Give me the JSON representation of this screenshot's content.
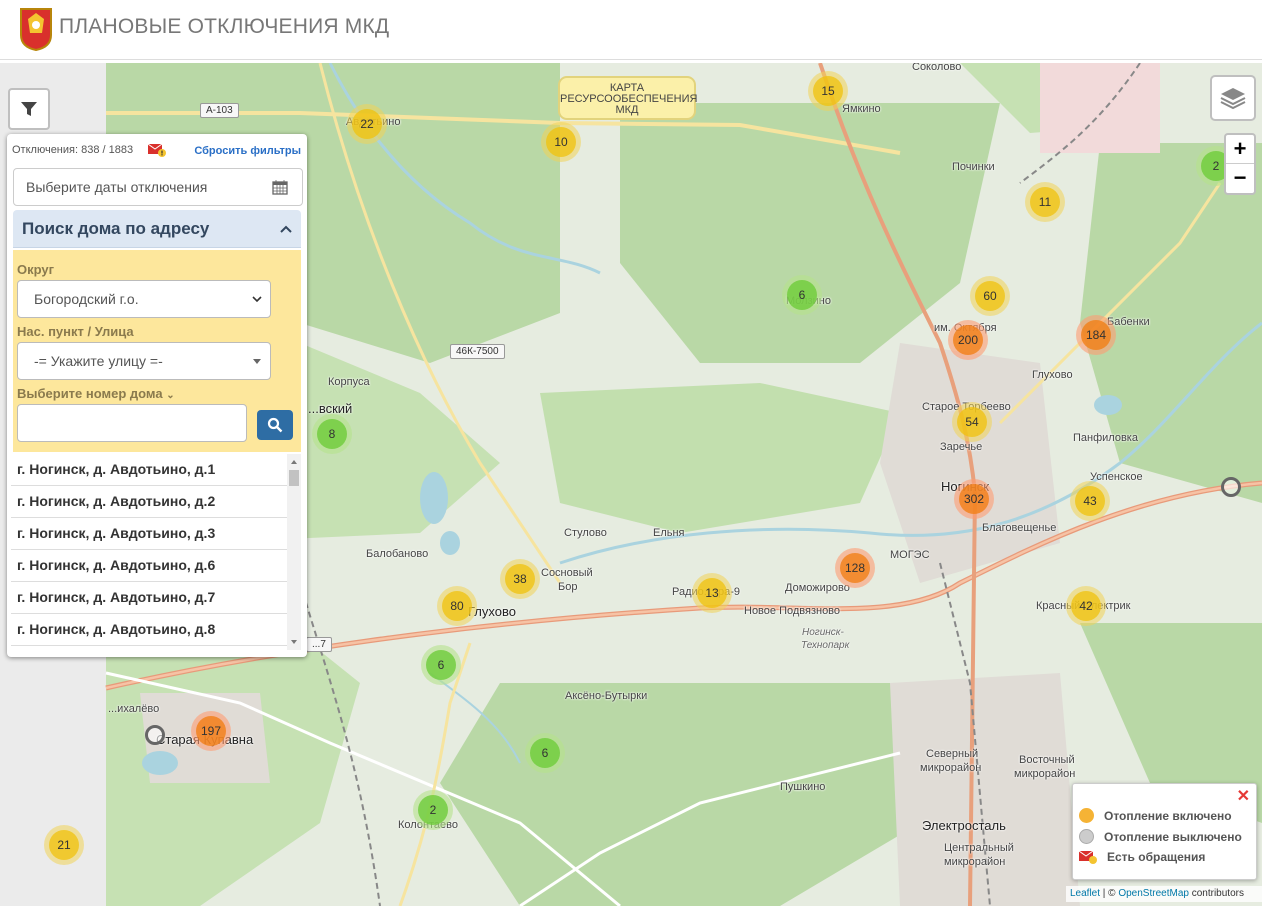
{
  "header": {
    "title": "ПЛАНОВЫЕ ОТКЛЮЧЕНИЯ МКД"
  },
  "map": {
    "overlay_label": [
      "КАРТА",
      "РЕСУРСООБЕСПЕЧЕНИЯ",
      "МКД"
    ],
    "clusters": [
      "22",
      "10",
      "15",
      "2",
      "11",
      "6",
      "60",
      "200",
      "184",
      "8",
      "54",
      "302",
      "43",
      "38",
      "80",
      "13",
      "128",
      "42",
      "6",
      "6",
      "2",
      "197",
      "21"
    ],
    "place_labels": [
      "Соколово",
      "Ямкино",
      "Починки",
      "Авдотьино",
      "Молзино",
      "им. Октября",
      "Бабенки",
      "Глухово",
      "Старое Торбеево",
      "Заречье",
      "Панфиловка",
      "Ногинск",
      "Успенское",
      "Благовещенье",
      "Корпуса",
      "...вский",
      "Стулово",
      "Ельня",
      "Балобаново",
      "Сосновый",
      "Бор",
      "Глухово",
      "Радио...тра-9",
      "Доможирово",
      "МОГЭС",
      "Новое Подвязново",
      "Ногинск-",
      "Технопарк",
      "Красный Электрик",
      "Аксёно-Бутырки",
      "...ихалёво",
      "Старая Купавна",
      "Северный",
      "микрорайон",
      "Восточный",
      "микрорайон",
      "Пушкино",
      "Электросталь",
      "Центральный",
      "микрорайон",
      "Колонтаево"
    ],
    "road_shields": [
      "А-103",
      "46К-7500",
      "...7"
    ]
  },
  "panel": {
    "stats": "Отключения: 838 / 1883",
    "reset_label": "Сбросить фильтры",
    "date_placeholder": "Выберите даты отключения",
    "search_title": "Поиск дома по адресу",
    "district_label": "Округ",
    "district_value": "Богородский г.о.",
    "street_label": "Нас. пункт / Улица",
    "street_value": "-= Укажите улицу =-",
    "house_label": "Выберите номер дома",
    "results": [
      "г. Ногинск, д. Авдотьино, д.1",
      "г. Ногинск, д. Авдотьино, д.2",
      "г. Ногинск, д. Авдотьино, д.3",
      "г. Ногинск, д. Авдотьино, д.6",
      "г. Ногинск, д. Авдотьино, д.7",
      "г. Ногинск, д. Авдотьино, д.8"
    ]
  },
  "controls": {
    "zoom_in": "+",
    "zoom_out": "−"
  },
  "legend": {
    "close": "✕",
    "items": [
      {
        "label": "Отопление включено",
        "color": "#f5b335"
      },
      {
        "label": "Отопление выключено",
        "color": "#cccccc"
      },
      {
        "label": "Есть обращения",
        "icon": "mail-alert-icon"
      }
    ]
  },
  "attribution": {
    "leaflet": "Leaflet",
    "separator": " | © ",
    "osm": "OpenStreetMap",
    "suffix": " contributors"
  },
  "colors": {
    "accent": "#2e6da4",
    "panel_yellow": "#fde79c",
    "header_blue": "#dde7f3"
  }
}
